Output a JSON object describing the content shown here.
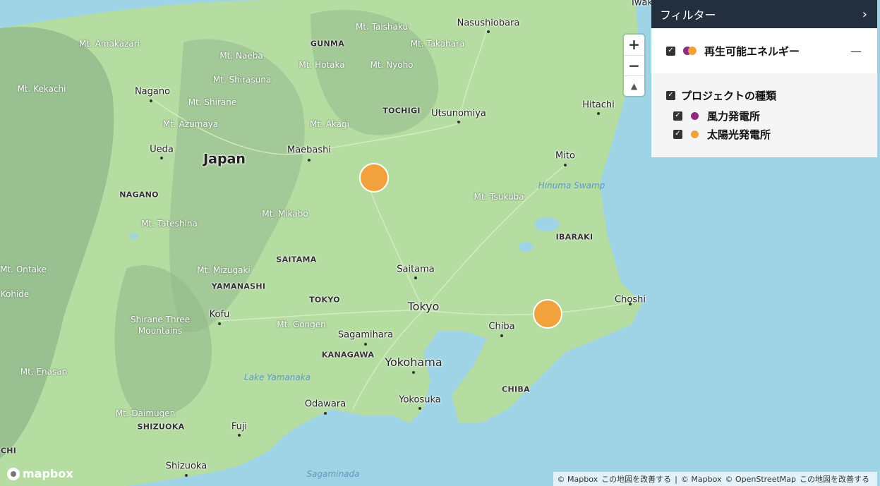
{
  "map": {
    "labels": [
      {
        "text": "Mt. Amakazari",
        "kind": "peak"
      },
      {
        "text": "Mt. Naeba",
        "kind": "peak"
      },
      {
        "text": "GUNMA",
        "kind": "pref"
      },
      {
        "text": "Mt. Taishaku",
        "kind": "peak"
      },
      {
        "text": "Nasushiobara",
        "kind": "city"
      },
      {
        "text": "Iwak",
        "kind": "city"
      },
      {
        "text": "Mt. Takahara",
        "kind": "peak"
      },
      {
        "text": "Mt. Hotaka",
        "kind": "peak"
      },
      {
        "text": "Mt. Nyoho",
        "kind": "peak"
      },
      {
        "text": "Mt. Shirasuna",
        "kind": "peak"
      },
      {
        "text": "Mt. Kekachi",
        "kind": "peak"
      },
      {
        "text": "Nagano",
        "kind": "city"
      },
      {
        "text": "Mt. Shirane",
        "kind": "peak"
      },
      {
        "text": "TOCHIGI",
        "kind": "pref"
      },
      {
        "text": "Utsunomiya",
        "kind": "city"
      },
      {
        "text": "Hitachi",
        "kind": "city"
      },
      {
        "text": "Mt. Azumaya",
        "kind": "peak"
      },
      {
        "text": "Mt. Akagi",
        "kind": "peak"
      },
      {
        "text": "Ueda",
        "kind": "city"
      },
      {
        "text": "Maebashi",
        "kind": "city"
      },
      {
        "text": "Mito",
        "kind": "city"
      },
      {
        "text": "Japan",
        "kind": "country"
      },
      {
        "text": "Hinuma Swamp",
        "kind": "water"
      },
      {
        "text": "NAGANO",
        "kind": "pref"
      },
      {
        "text": "Mt. Tsukuba",
        "kind": "peak"
      },
      {
        "text": "Mt. Mikabo",
        "kind": "peak"
      },
      {
        "text": "Mt. Tateshina",
        "kind": "peak"
      },
      {
        "text": "IBARAKI",
        "kind": "pref"
      },
      {
        "text": "SAITAMA",
        "kind": "pref"
      },
      {
        "text": "Mt. Ontake",
        "kind": "peak"
      },
      {
        "text": "Mt. Mizugaki",
        "kind": "peak"
      },
      {
        "text": "Saitama",
        "kind": "city"
      },
      {
        "text": "YAMANASHI",
        "kind": "pref"
      },
      {
        "text": "Kohide",
        "kind": "peak"
      },
      {
        "text": "TOKYO",
        "kind": "pref"
      },
      {
        "text": "Choshi",
        "kind": "city"
      },
      {
        "text": "Tokyo",
        "kind": "city-big"
      },
      {
        "text": "Kofu",
        "kind": "city"
      },
      {
        "text": "Shirane Three",
        "kind": "peak"
      },
      {
        "text": "Mountains",
        "kind": "peak"
      },
      {
        "text": "Mt. Gongen",
        "kind": "peak"
      },
      {
        "text": "Chiba",
        "kind": "city"
      },
      {
        "text": "Sagamihara",
        "kind": "city"
      },
      {
        "text": "KANAGAWA",
        "kind": "pref"
      },
      {
        "text": "Yokohama",
        "kind": "city-big"
      },
      {
        "text": "Mt. Enasan",
        "kind": "peak"
      },
      {
        "text": "Lake Yamanaka",
        "kind": "water"
      },
      {
        "text": "CHIBA",
        "kind": "pref"
      },
      {
        "text": "Odawara",
        "kind": "city"
      },
      {
        "text": "Yokosuka",
        "kind": "city"
      },
      {
        "text": "Mt. Daimugen",
        "kind": "peak"
      },
      {
        "text": "SHIZUOKA",
        "kind": "pref"
      },
      {
        "text": "Fuji",
        "kind": "city"
      },
      {
        "text": "CHI",
        "kind": "pref"
      },
      {
        "text": "Shizuoka",
        "kind": "city"
      },
      {
        "text": "Sagaminada",
        "kind": "water"
      }
    ],
    "markers": [
      {
        "name": "solar-marker-gunma",
        "type": "太陽光発電所",
        "color": "#f2a23c"
      },
      {
        "name": "solar-marker-chiba",
        "type": "太陽光発電所",
        "color": "#f2a23c"
      }
    ]
  },
  "controls": {
    "zoom_in": "+",
    "zoom_out": "−",
    "compass": "▲"
  },
  "filter": {
    "title": "フィルター",
    "chevron": "›",
    "group": {
      "label": "再生可能エネルギー",
      "checked": true,
      "collapse_symbol": "—",
      "swatch_colors": [
        "#8e2a82",
        "#f2a23c"
      ]
    },
    "types": {
      "label": "プロジェクトの種類",
      "checked": true,
      "items": [
        {
          "label": "風力発電所",
          "color": "#8e2a82",
          "checked": true
        },
        {
          "label": "太陽光発電所",
          "color": "#f2a23c",
          "checked": true
        }
      ]
    }
  },
  "attribution": {
    "mapbox": "© Mapbox",
    "improve1": "この地図を改善する",
    "sep": "|",
    "mapbox2": "© Mapbox",
    "osm": "© OpenStreetMap",
    "improve2": "この地図を改善する"
  },
  "logo": {
    "text": "mapbox"
  }
}
